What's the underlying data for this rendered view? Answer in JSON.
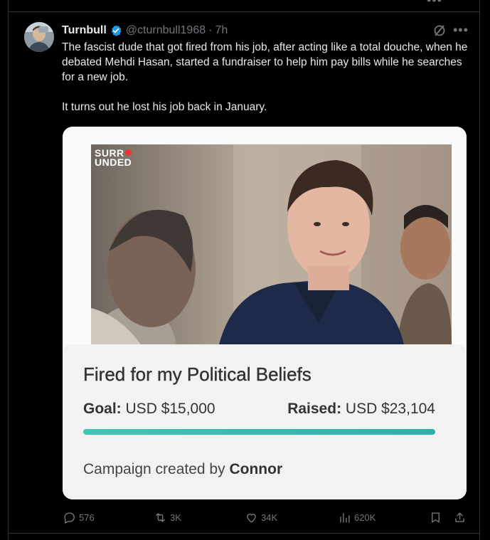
{
  "tweet": {
    "display_name": "Turnbull",
    "handle": "@cturnbull1968",
    "separator": "·",
    "time": "7h",
    "paragraphs": [
      "The fascist dude that got fired from his job, after acting like a total douche, when he debated Mehdi Hasan, started a fundraiser to help him pay bills while he searches for a new job.",
      "It turns out he lost his job back in January."
    ]
  },
  "card": {
    "watermark_line1": "SURR",
    "watermark_line2": "UNDED",
    "title": "Fired for my Political Beliefs",
    "goal_label": "Goal:",
    "goal_value": "USD $15,000",
    "raised_label": "Raised:",
    "raised_value": "USD $23,104",
    "progress_fraction": 1.0,
    "created_prefix": "Campaign created by",
    "creator": "Connor"
  },
  "actions": {
    "replies": "576",
    "reposts": "3K",
    "likes": "34K",
    "views": "620K"
  },
  "colors": {
    "background": "#000000",
    "verified_blue": "#1d9bf0",
    "progress": "#2cbaa9",
    "muted_text": "#71767b"
  },
  "icons": [
    "verified-badge-icon",
    "grok-icon",
    "more-icon",
    "reply-icon",
    "repost-icon",
    "like-icon",
    "views-icon",
    "bookmark-icon",
    "share-icon"
  ]
}
